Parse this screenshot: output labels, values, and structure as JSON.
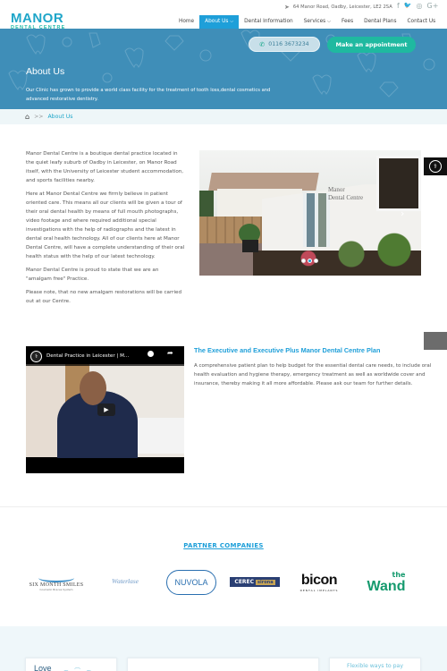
{
  "header": {
    "logo_main": "MANOR",
    "logo_sub": "DENTAL CENTRE",
    "address": "64 Manor Road, Oadby, Leicester, LE2 2SA",
    "address_icon": "➤",
    "socials": [
      {
        "name": "facebook",
        "glyph": "f"
      },
      {
        "name": "twitter",
        "glyph": "🐦"
      },
      {
        "name": "instagram",
        "glyph": "◎"
      },
      {
        "name": "google-plus",
        "glyph": "G+"
      }
    ],
    "nav": [
      {
        "label": "Home",
        "active": false,
        "dropdown": false
      },
      {
        "label": "About Us",
        "active": true,
        "dropdown": true
      },
      {
        "label": "Dental Information",
        "active": false,
        "dropdown": false
      },
      {
        "label": "Services",
        "active": false,
        "dropdown": true
      },
      {
        "label": "Fees",
        "active": false,
        "dropdown": false
      },
      {
        "label": "Dental Plans",
        "active": false,
        "dropdown": false
      },
      {
        "label": "Contact Us",
        "active": false,
        "dropdown": false
      }
    ],
    "chevron": "⌵"
  },
  "hero": {
    "phone_icon": "✆",
    "phone": "0116 3673234",
    "appointment_label": "Make an appointment",
    "title": "About Us",
    "description": "Our Clinic has grown to provide a world class facility for the treatment of tooth loss,dental cosmetics and advanced restorative dentistry."
  },
  "breadcrumb": {
    "home_icon": "⌂",
    "separator": ">>",
    "current": "About Us"
  },
  "intro": {
    "paragraphs": [
      "Manor Dental Centre is a boutique dental practice located in the quiet leafy suburb of Oadby in Leicester, on Manor Road itself, with the University of Leicester student accommodation, and sports facilities nearby.",
      "Here at Manor Dental Centre we firmly believe in patient oriented care. This means all our clients will be given a tour of their oral dental health by means of full mouth photographs, video footage and where required additional special investigations with the help of radiographs and the latest in dental oral health technology. All of our clients here at Manor Dental Centre, will have a complete understanding of their oral health status with the help of our latest technology.",
      "Manor Dental Centre is proud to state that we are an \"amalgam free\" Practice.",
      "Please note, that no new amalgam restorations will be carried out at our Centre."
    ]
  },
  "slider": {
    "sign_text": "Manor\nDental Centre",
    "next_icon": "›",
    "slide_count": 3,
    "active_slide": 2
  },
  "side_badge": {
    "glyph": "⚕"
  },
  "video": {
    "channel_glyph": "⚕",
    "title": "Dental Practice in Leicester | M...",
    "watch_later_icon": "clock",
    "share_icon": "➦",
    "play_icon": "▶"
  },
  "plan": {
    "title": "The Executive and Executive Plus Manor Dental Centre Plan",
    "description": "A comprehensive patient plan to help budget for the essential dental care needs, to include oral health evaluation and hygiene therapy, emergency treatment as well as worldwide cover and insurance, thereby making it all more affordable. Please ask our team for further details."
  },
  "partners": {
    "title": "PARTNER COMPANIES",
    "items": [
      {
        "name": "Six Month Smiles",
        "label": "SIX MONTH SMILES",
        "sub": "Cosmetic Braces System"
      },
      {
        "name": "Waterlase",
        "label": "Waterlase"
      },
      {
        "name": "Nuvola",
        "label": "NUVOLA"
      },
      {
        "name": "Cerec Sirona",
        "label": "CEREC",
        "sub": "sirona"
      },
      {
        "name": "Bicon",
        "label": "bicon",
        "sub": "DENTAL IMPLANTS"
      },
      {
        "name": "The Wand",
        "label": "Wand",
        "small": "the"
      }
    ]
  },
  "footer_cards": {
    "love_text": "Love",
    "love_swirl": "~ ⌒ ~",
    "flexible_text": "Flexible ways to pay"
  }
}
